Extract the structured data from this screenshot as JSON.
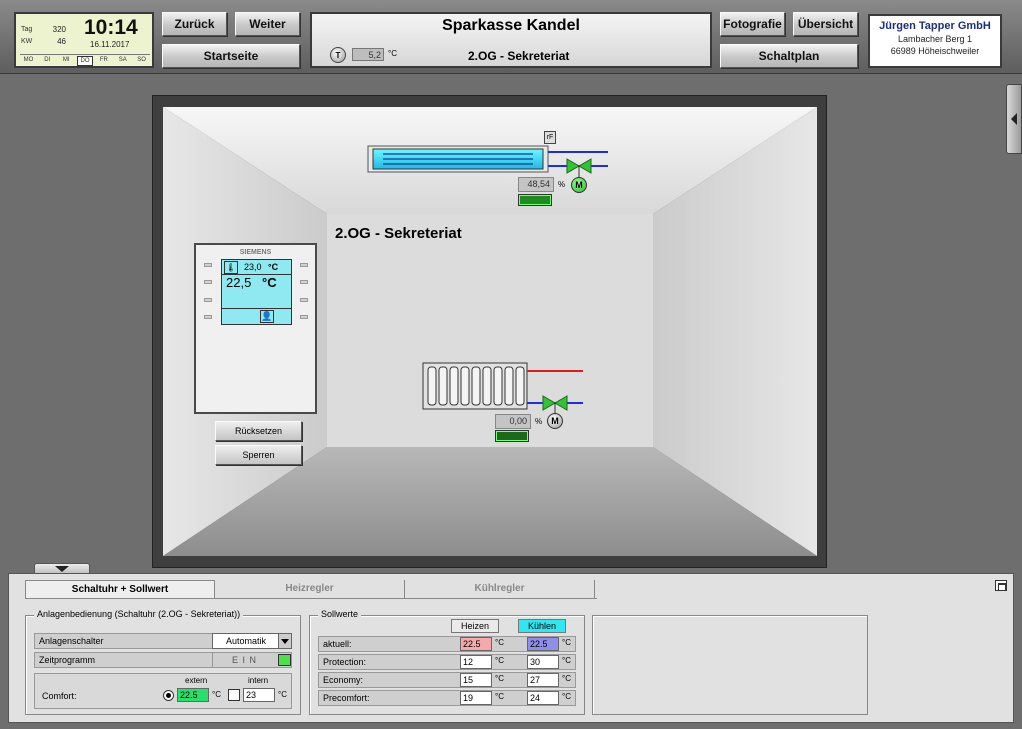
{
  "clock": {
    "tag_label": "Tag",
    "tag_value": "320",
    "kw_label": "KW",
    "kw_value": "46",
    "time": "10:14",
    "date": "16.11.2017",
    "days": [
      "MO",
      "DI",
      "MI",
      "DO",
      "FR",
      "SA",
      "SO"
    ],
    "active_day": "DO"
  },
  "nav": {
    "back_label": "Zurück",
    "forward_label": "Weiter",
    "home_label": "Startseite",
    "photo_label": "Fotografie",
    "overview_label": "Übersicht",
    "plan_label": "Schaltplan"
  },
  "title": {
    "site": "Sparkasse Kandel",
    "room": "2.OG - Sekreteriat",
    "outdoor_icon": "T",
    "outdoor_temp": "5,2",
    "outdoor_unit": "°C"
  },
  "company": {
    "name": "Jürgen Tapper GmbH",
    "street": "Lambacher Berg 1",
    "city": "66989 Höheischweiler"
  },
  "room_view": {
    "title": "2.OG - Sekreteriat",
    "cooling_ceiling": {
      "rf_label": "rF",
      "valve_value": "48,54",
      "unit": "%",
      "motor_label": "M"
    },
    "radiator": {
      "valve_value": "0,00",
      "unit": "%",
      "motor_label": "M"
    },
    "thermostat": {
      "brand": "SIEMENS",
      "setpoint": "23,0",
      "setpoint_unit": "°C",
      "actual": "22,5",
      "actual_unit": "°C"
    },
    "reset_label": "Rücksetzen",
    "lock_label": "Sperren"
  },
  "bottom_tabs": [
    {
      "label": "Schaltuhr + Sollwert",
      "active": true
    },
    {
      "label": "Heizregler",
      "active": false
    },
    {
      "label": "Kühlregler",
      "active": false
    }
  ],
  "operation": {
    "title": "Anlagenbedienung  (Schaltuhr (2.OG - Sekreteriat))",
    "switch_label": "Anlagenschalter",
    "switch_value": "Automatik",
    "program_label": "Zeitprogramm",
    "program_value": "E I N",
    "comfort_label": "Comfort:",
    "extern_label": "extern",
    "intern_label": "intern",
    "extern_value": "22.5",
    "intern_value": "23",
    "unit": "°C"
  },
  "setpoints": {
    "title": "Sollwerte",
    "heat_label": "Heizen",
    "cool_label": "Kühlen",
    "unit": "°C",
    "rows": [
      {
        "label": "aktuell:",
        "heat": "22.5",
        "cool": "22.5"
      },
      {
        "label": "Protection:",
        "heat": "12",
        "cool": "30"
      },
      {
        "label": "Economy:",
        "heat": "15",
        "cool": "27"
      },
      {
        "label": "Precomfort:",
        "heat": "19",
        "cool": "24"
      }
    ]
  },
  "colors": {
    "heat_highlight": "#f4aaaa",
    "cool_highlight": "#8f8fe9",
    "extern_highlight": "#27e06b",
    "display": "#8fe9f1",
    "kuehlen_tab": "#2fe7f0"
  }
}
